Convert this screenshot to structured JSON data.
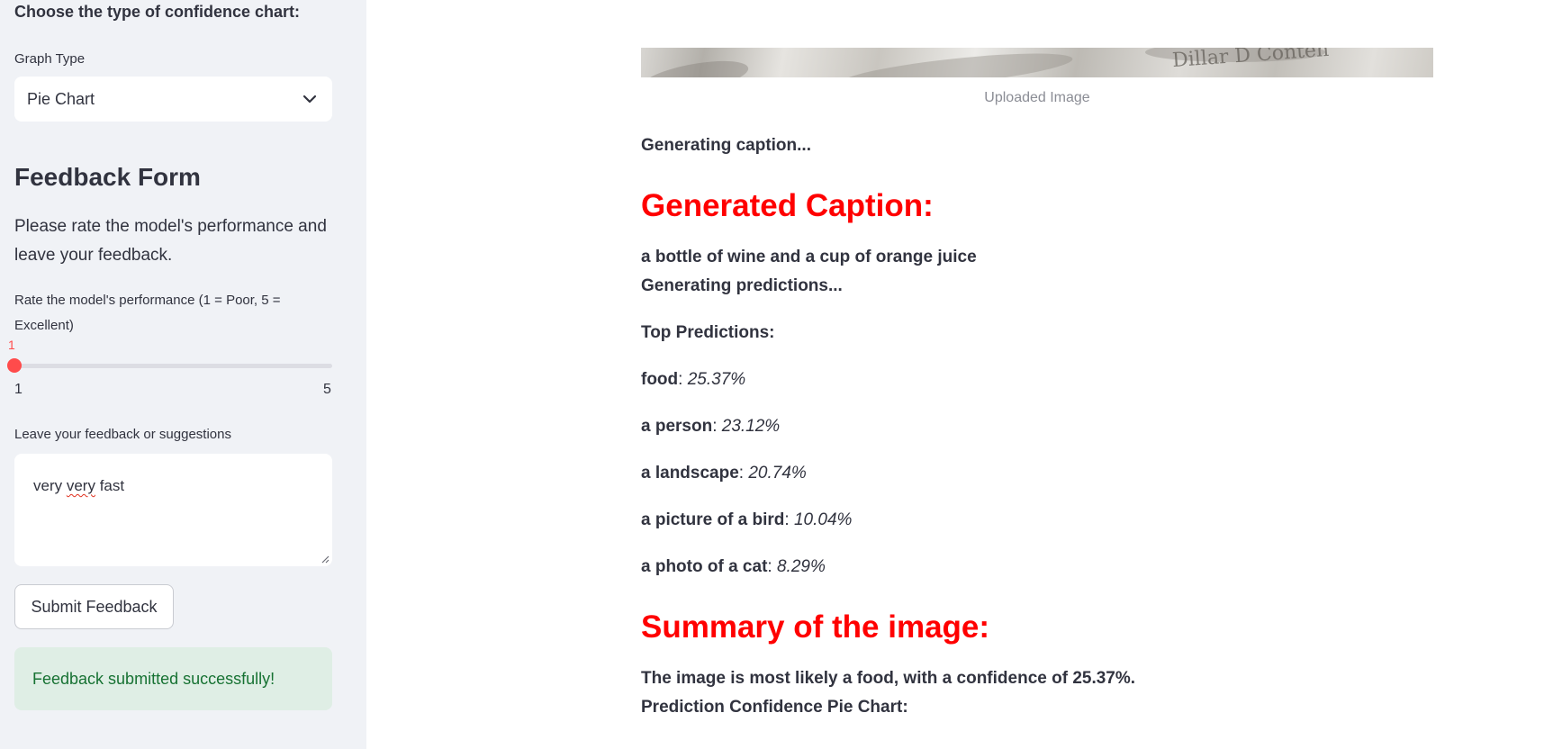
{
  "sidebar": {
    "chart_type_heading": "Choose the type of confidence chart:",
    "graph_type_label": "Graph Type",
    "graph_type_value": "Pie Chart",
    "feedback_title": "Feedback Form",
    "feedback_desc": "Please rate the model's performance and leave your feedback.",
    "rate_label": "Rate the model's performance (1 = Poor, 5 = Excellent)",
    "slider": {
      "value": "1",
      "min": "1",
      "max": "5",
      "accent": "#ff4b4b"
    },
    "feedback_label": "Leave your feedback or suggestions",
    "feedback_text": {
      "word1": "very ",
      "word2": "very",
      "word3": " fast"
    },
    "submit_label": "Submit Feedback",
    "success_message": "Feedback submitted successfully!"
  },
  "main": {
    "image_caption": "Uploaded Image",
    "image_text_fragment": "Dillar D Conten",
    "generating_caption": "Generating caption...",
    "generated_caption_heading": "Generated Caption:",
    "caption_text": "a bottle of wine and a cup of orange juice",
    "generating_predictions": "Generating predictions...",
    "top_predictions_label": "Top Predictions:",
    "predictions": [
      {
        "label": "food",
        "sep": ": ",
        "value": "25.37%"
      },
      {
        "label": "a person",
        "sep": ": ",
        "value": "23.12%"
      },
      {
        "label": "a landscape",
        "sep": ": ",
        "value": "20.74%"
      },
      {
        "label": "a picture of a bird",
        "sep": ": ",
        "value": "10.04%"
      },
      {
        "label": "a photo of a cat",
        "sep": ": ",
        "value": "8.29%"
      }
    ],
    "summary_heading": "Summary of the image:",
    "summary_text": "The image is most likely a food, with a confidence of 25.37%.",
    "pie_chart_label": "Prediction Confidence Pie Chart:",
    "heading_color": "#ff0000"
  }
}
